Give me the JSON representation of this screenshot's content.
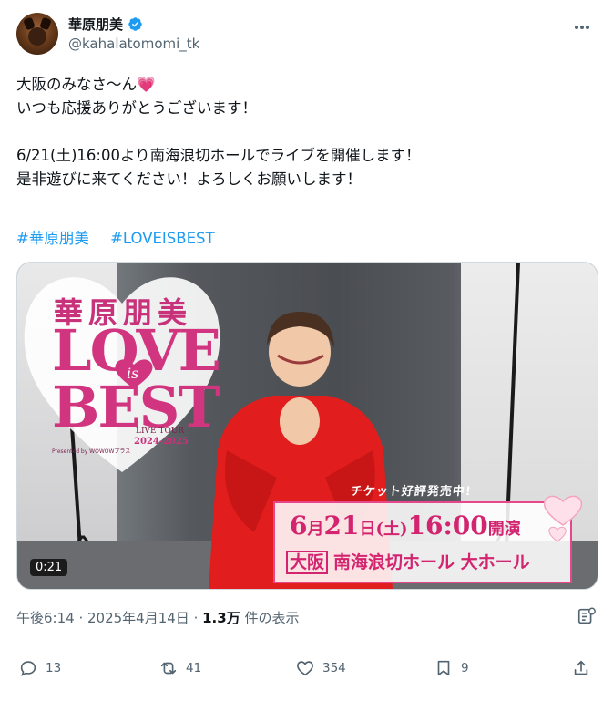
{
  "author": {
    "display_name": "華原朋美",
    "handle": "@kahalatomomi_tk",
    "verified": true
  },
  "tweet": {
    "text": "大阪のみなさ〜ん💗\nいつも応援ありがとうございます！\n\n6/21(土)16:00より南海浪切ホールでライブを開催します！\n是非遊びに来てください！よろしくお願いします！",
    "hashtags": [
      "#華原朋美",
      "#LOVEISBEST"
    ]
  },
  "media": {
    "logo_name": "華原朋美",
    "logo_love": "LOVE",
    "logo_is": "is",
    "logo_best": "BEST",
    "tour_label": "LIVE TOUR",
    "tour_years": "2024-2025",
    "presented_by": "Presented by WOWOWプラス",
    "ticket_banner": "チケット好評発売中!",
    "date_month": "6",
    "date_month_unit": "月",
    "date_day": "21",
    "date_day_unit": "日",
    "date_weekday": "(土)",
    "date_time": "16:00",
    "date_suffix": "開演",
    "venue_city": "大阪",
    "venue_name": "南海浪切ホール 大ホール",
    "duration": "0:21"
  },
  "meta": {
    "time": "午後6:14",
    "date": "2025年4月14日",
    "views_count": "1.3万",
    "views_label": "件の表示"
  },
  "actions": {
    "replies": "13",
    "reposts": "41",
    "likes": "354",
    "bookmarks": "9"
  },
  "colors": {
    "accent": "#1d9bf0",
    "secondary_text": "#536471",
    "brand_pink": "#d3246f"
  }
}
